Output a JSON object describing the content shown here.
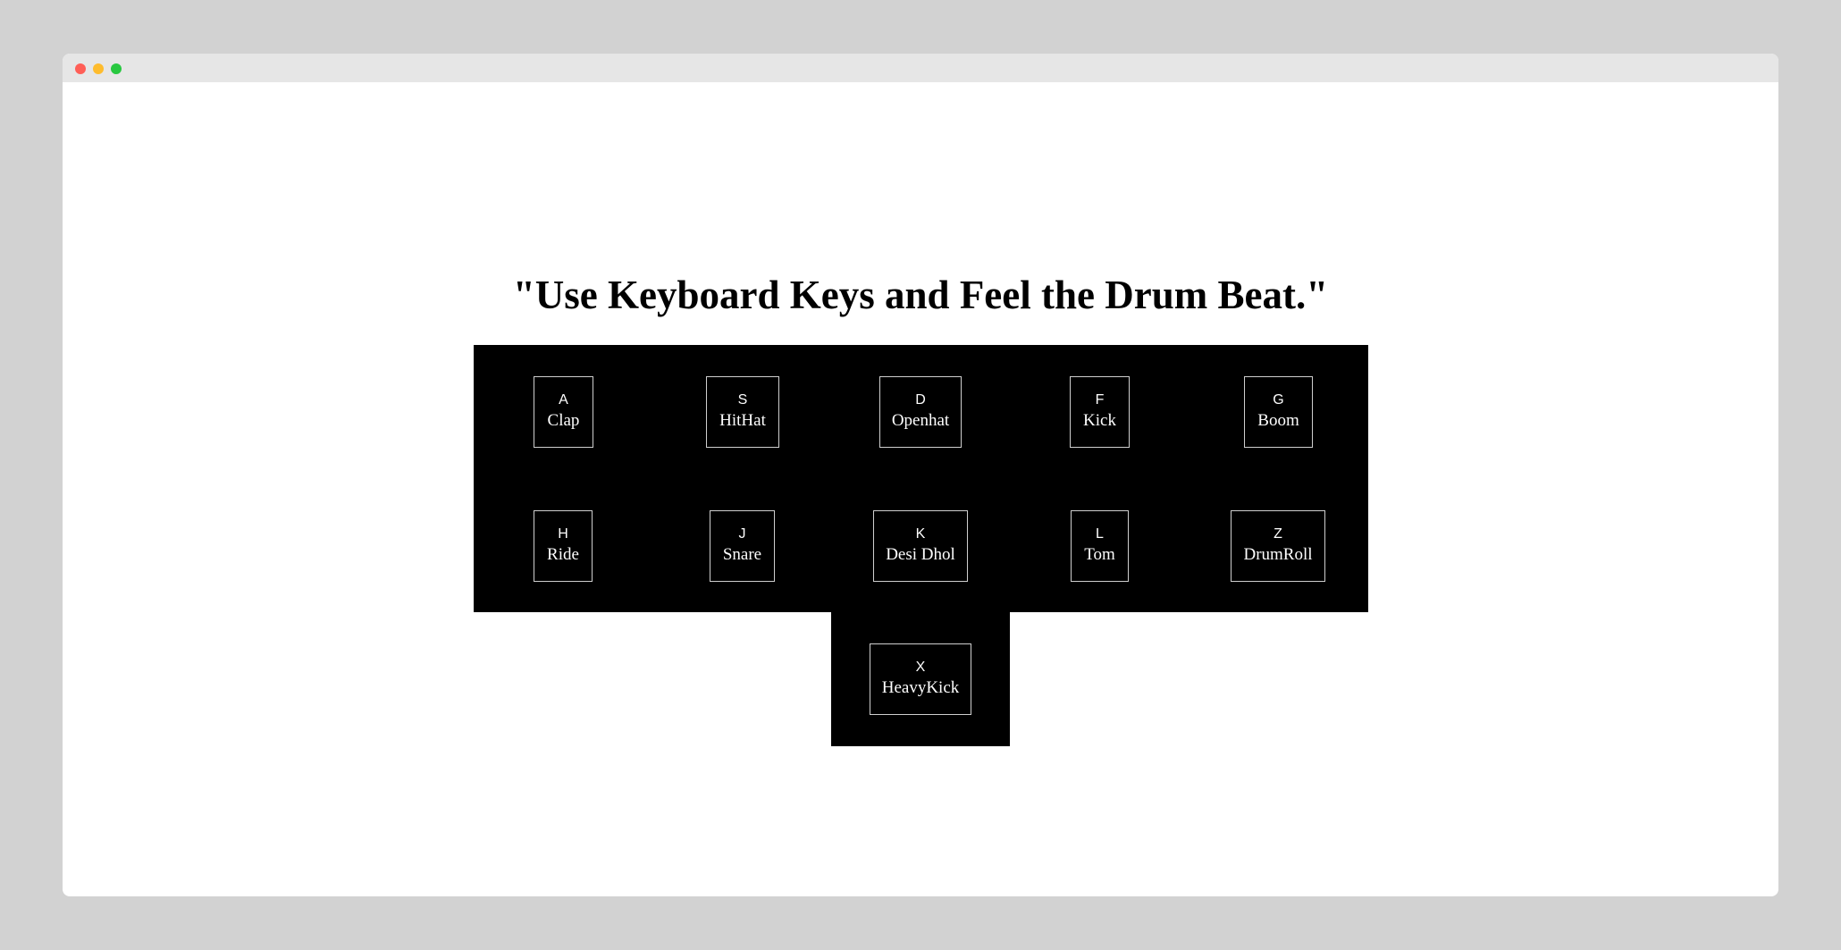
{
  "heading": "\"Use Keyboard Keys and Feel the Drum Beat.\"",
  "colors": {
    "panel": "#000000",
    "key_text": "#ffffff",
    "key_border": "#cfcfcf",
    "page_bg": "#ffffff"
  },
  "keys": [
    {
      "key": "A",
      "sound": "Clap"
    },
    {
      "key": "S",
      "sound": "HitHat"
    },
    {
      "key": "D",
      "sound": "Openhat"
    },
    {
      "key": "F",
      "sound": "Kick"
    },
    {
      "key": "G",
      "sound": "Boom"
    },
    {
      "key": "H",
      "sound": "Ride"
    },
    {
      "key": "J",
      "sound": "Snare"
    },
    {
      "key": "K",
      "sound": "Desi Dhol"
    },
    {
      "key": "L",
      "sound": "Tom"
    },
    {
      "key": "Z",
      "sound": "DrumRoll"
    },
    {
      "key": "X",
      "sound": "HeavyKick"
    }
  ]
}
